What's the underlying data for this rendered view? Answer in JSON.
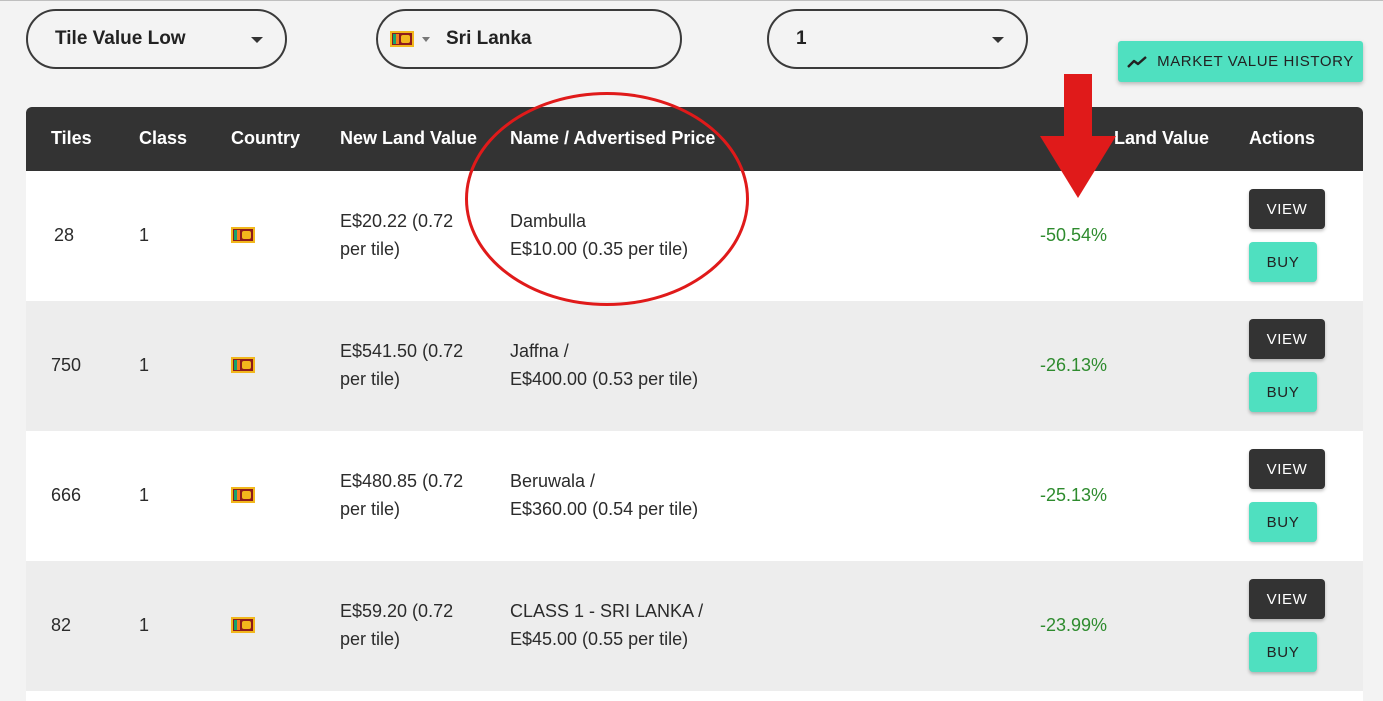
{
  "filters": {
    "sort_value": "Tile Value Low",
    "country_value": "Sri Lanka",
    "class_value": "1"
  },
  "market_value_history_label": "MARKET VALUE HISTORY",
  "table": {
    "headers": {
      "tiles": "Tiles",
      "class": "Class",
      "country": "Country",
      "new_land_value": "New Land Value",
      "name_price": "Name / Advertised Price",
      "percent_land_value": "% ... Land Value",
      "percent_land_value_visible": "Land Value",
      "actions": "Actions"
    },
    "rows": [
      {
        "tiles": "28",
        "class": "1",
        "country": "Sri Lanka",
        "land_value_line1": "E$20.22 (0.72",
        "land_value_line2": "per tile)",
        "name_line1": "Dambulla",
        "name_line2": "E$10.00 (0.35 per tile)",
        "percent": "-50.54%"
      },
      {
        "tiles": "750",
        "class": "1",
        "country": "Sri Lanka",
        "land_value_line1": "E$541.50 (0.72",
        "land_value_line2": "per tile)",
        "name_line1": "Jaffna /",
        "name_line2": "E$400.00 (0.53 per tile)",
        "percent": "-26.13%"
      },
      {
        "tiles": "666",
        "class": "1",
        "country": "Sri Lanka",
        "land_value_line1": "E$480.85 (0.72",
        "land_value_line2": "per tile)",
        "name_line1": "Beruwala /",
        "name_line2": "E$360.00 (0.54 per tile)",
        "percent": "-25.13%"
      },
      {
        "tiles": "82",
        "class": "1",
        "country": "Sri Lanka",
        "land_value_line1": "E$59.20 (0.72",
        "land_value_line2": "per tile)",
        "name_line1": "CLASS 1 - SRI LANKA /",
        "name_line2": "E$45.00 (0.55 per tile)",
        "percent": "-23.99%"
      }
    ],
    "view_label": "VIEW",
    "buy_label": "BUY"
  },
  "colors": {
    "header_bg": "#333333",
    "accent_teal": "#4fe0c0",
    "positive_green": "#2e8b2e",
    "annotation_red": "#e01a1a"
  },
  "icons": [
    "caret-down-icon",
    "trend-line-icon",
    "sri-lanka-flag-icon"
  ]
}
